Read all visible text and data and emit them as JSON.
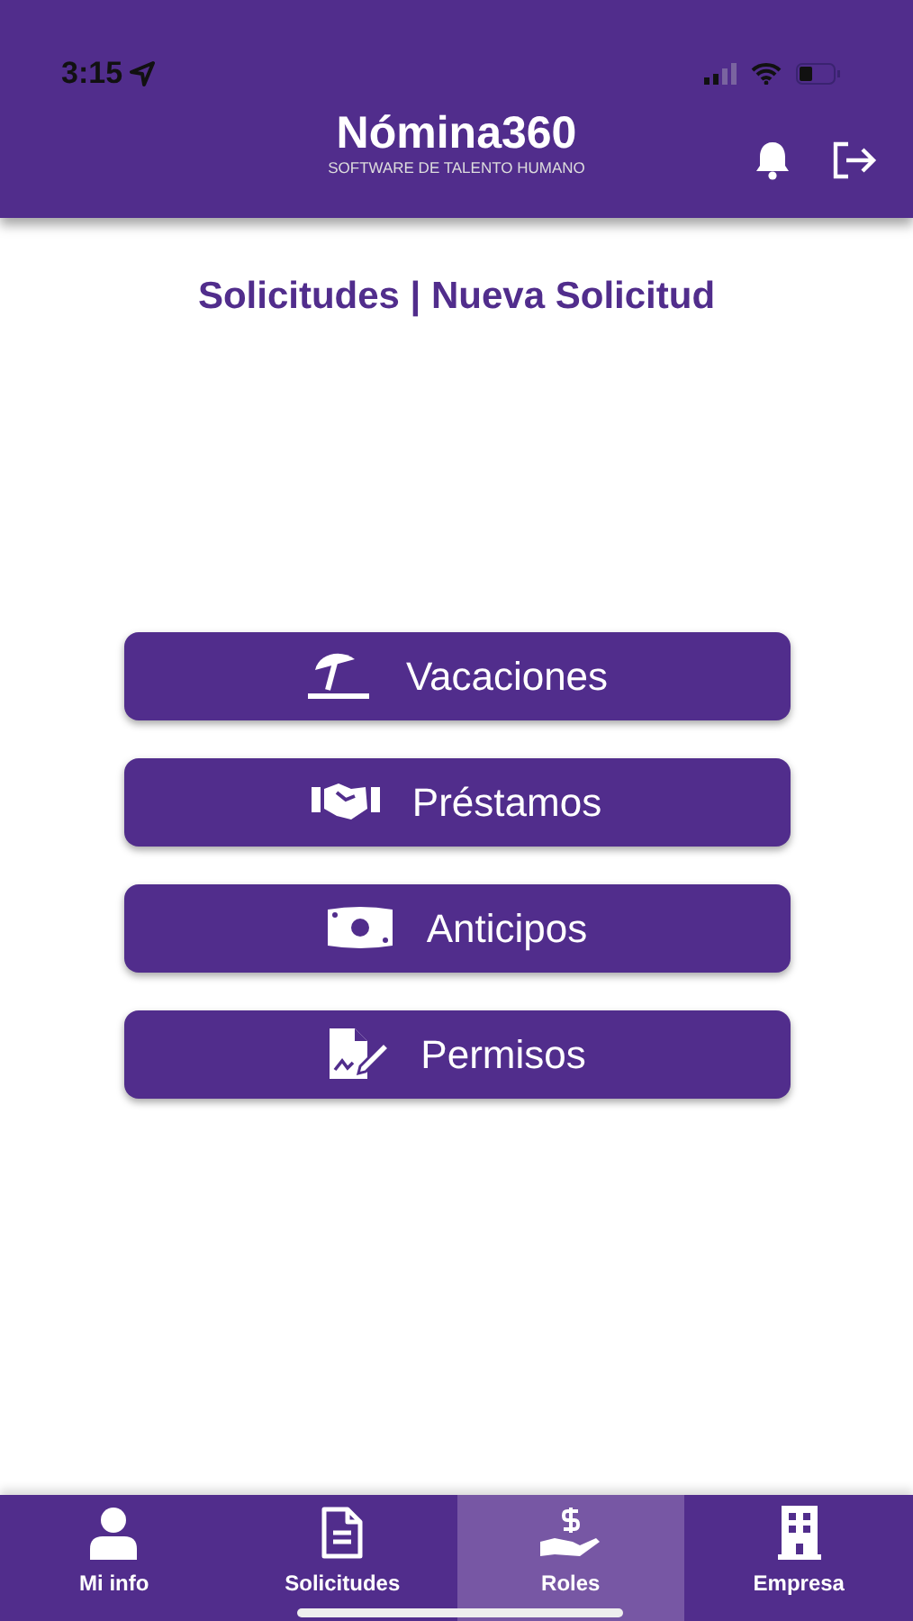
{
  "status_bar": {
    "time": "3:15"
  },
  "header": {
    "title": "Nómina360",
    "subtitle": "SOFTWARE DE TALENTO HUMANO"
  },
  "page_title": "Solicitudes | Nueva Solicitud",
  "options": [
    {
      "label": "Vacaciones",
      "kind": "umbrella"
    },
    {
      "label": "Préstamos",
      "kind": "handshake"
    },
    {
      "label": "Anticipos",
      "kind": "money"
    },
    {
      "label": "Permisos",
      "kind": "document"
    }
  ],
  "tabs": [
    {
      "label": "Mi info",
      "kind": "user",
      "selected": false
    },
    {
      "label": "Solicitudes",
      "kind": "file",
      "selected": false
    },
    {
      "label": "Roles",
      "kind": "hand",
      "selected": true
    },
    {
      "label": "Empresa",
      "kind": "building",
      "selected": false
    }
  ]
}
